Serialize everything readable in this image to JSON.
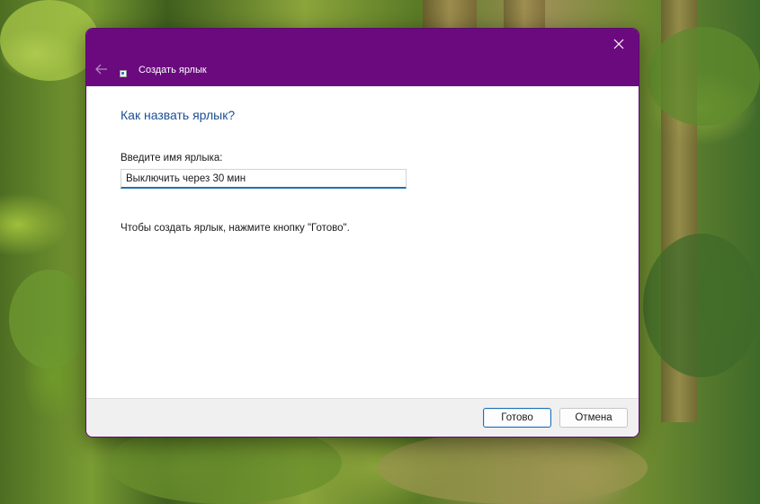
{
  "window": {
    "title": "Создать ярлык",
    "accent_color": "#6b0a7e"
  },
  "icons": {
    "back": "back-arrow-icon",
    "close": "close-icon",
    "shortcut": "shortcut-icon"
  },
  "content": {
    "heading": "Как назвать ярлык?",
    "field_label": "Введите имя ярлыка:",
    "name_value": "Выключить через 30 мин",
    "hint": "Чтобы создать ярлык, нажмите кнопку \"Готово\"."
  },
  "footer": {
    "finish_label": "Готово",
    "cancel_label": "Отмена"
  }
}
